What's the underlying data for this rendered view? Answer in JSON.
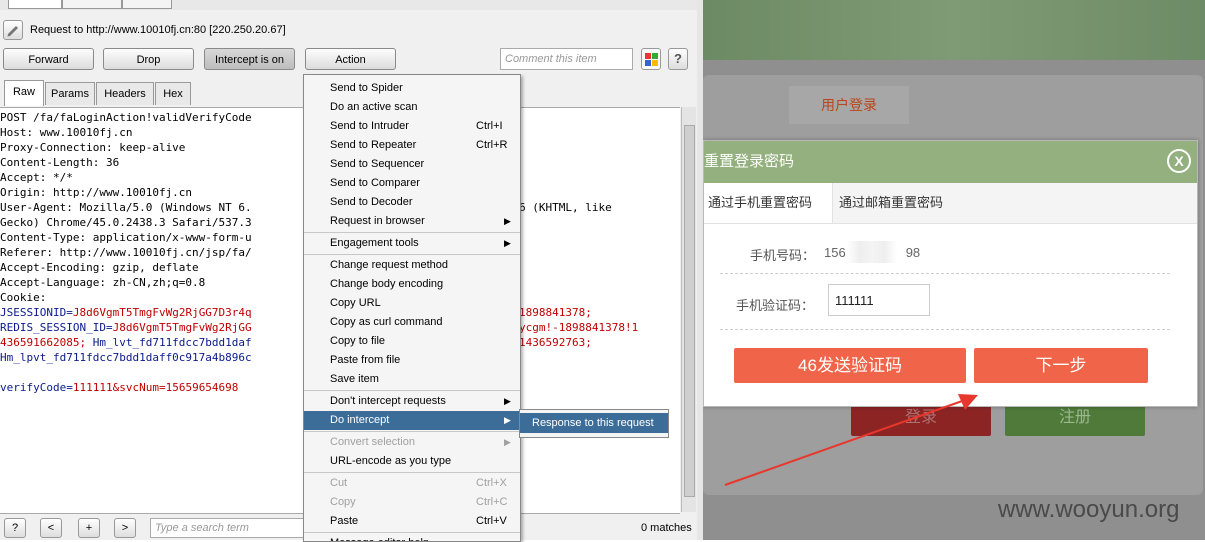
{
  "request_line": "Request to http://www.10010fj.cn:80  [220.250.20.67]",
  "toolbar": {
    "forward": "Forward",
    "drop": "Drop",
    "intercept": "Intercept is on",
    "action": "Action",
    "comment_placeholder": "Comment this item",
    "help": "?"
  },
  "tabs": [
    "Raw",
    "Params",
    "Headers",
    "Hex"
  ],
  "request_lines": [
    {
      "t": "POST /fa/faLoginAction!validVerifyCode",
      "c": ""
    },
    {
      "t": "Host: www.10010fj.cn",
      "c": ""
    },
    {
      "t": "Proxy-Connection: keep-alive",
      "c": ""
    },
    {
      "t": "Content-Length: 36",
      "c": ""
    },
    {
      "t": "Accept: */*",
      "c": ""
    },
    {
      "t": "Origin: http://www.10010fj.cn",
      "c": ""
    },
    {
      "t": "User-Agent: Mozilla/5.0 (Windows NT 6.",
      "c": ""
    },
    {
      "t": "Gecko) Chrome/45.0.2438.3 Safari/537.3",
      "c": ""
    },
    {
      "t": "Content-Type: application/x-www-form-u",
      "c": ""
    },
    {
      "t": "Referer: http://www.10010fj.cn/jsp/fa/",
      "c": ""
    },
    {
      "t": "Accept-Encoding: gzip, deflate",
      "c": ""
    },
    {
      "t": "Accept-Language: zh-CN,zh;q=0.8",
      "c": ""
    },
    {
      "t": "Cookie:",
      "c": ""
    },
    {
      "t": "JSESSIONID=J8d6VgmT5TmgFvWg2RjGG7D3r4q",
      "c": "mix1"
    },
    {
      "t": "REDIS_SESSION_ID=J8d6VgmT5TmgFvWg2RjGG",
      "c": "mix1"
    },
    {
      "t": "436591662085; Hm_lvt_fd711fdcc7bdd1daf",
      "c": "mix2"
    },
    {
      "t": "Hm_lpvt_fd711fdcc7bdd1daff0c917a4b896c",
      "c": "blue"
    },
    {
      "t": "",
      "c": ""
    },
    {
      "t": "verifyCode=111111&svcNum=15659654698",
      "c": "mix3"
    }
  ],
  "request_right": [
    {
      "line": 6,
      "t": "6 (KHTML, like"
    },
    {
      "line": 13,
      "t": "1898841378;",
      "c": "red"
    },
    {
      "line": 14,
      "t": "ycgm!-1898841378!1",
      "c": "red"
    },
    {
      "line": 15,
      "t": "1436592763;",
      "c": "red"
    }
  ],
  "context_menu": [
    {
      "label": "Send to Spider",
      "shortcut": ""
    },
    {
      "label": "Do an active scan",
      "shortcut": ""
    },
    {
      "label": "Send to Intruder",
      "shortcut": "Ctrl+I"
    },
    {
      "label": "Send to Repeater",
      "shortcut": "Ctrl+R"
    },
    {
      "label": "Send to Sequencer",
      "shortcut": ""
    },
    {
      "label": "Send to Comparer",
      "shortcut": ""
    },
    {
      "label": "Send to Decoder",
      "shortcut": ""
    },
    {
      "label": "Request in browser",
      "shortcut": "",
      "submenu": true
    },
    {
      "sep": true
    },
    {
      "label": "Engagement tools",
      "shortcut": "",
      "submenu": true
    },
    {
      "sep": true
    },
    {
      "label": "Change request method",
      "shortcut": ""
    },
    {
      "label": "Change body encoding",
      "shortcut": ""
    },
    {
      "label": "Copy URL",
      "shortcut": ""
    },
    {
      "label": "Copy as curl command",
      "shortcut": ""
    },
    {
      "label": "Copy to file",
      "shortcut": ""
    },
    {
      "label": "Paste from file",
      "shortcut": ""
    },
    {
      "label": "Save item",
      "shortcut": ""
    },
    {
      "sep": true
    },
    {
      "label": "Don't intercept requests",
      "shortcut": "",
      "submenu": true
    },
    {
      "label": "Do intercept",
      "shortcut": "",
      "submenu": true,
      "highlight": true
    },
    {
      "sep": true
    },
    {
      "label": "Convert selection",
      "shortcut": "",
      "submenu": true,
      "disabled": true
    },
    {
      "label": "URL-encode as you type",
      "shortcut": ""
    },
    {
      "sep": true
    },
    {
      "label": "Cut",
      "shortcut": "Ctrl+X",
      "disabled": true
    },
    {
      "label": "Copy",
      "shortcut": "Ctrl+C",
      "disabled": true
    },
    {
      "label": "Paste",
      "shortcut": "Ctrl+V"
    },
    {
      "sep": true
    },
    {
      "label": "Message editor help",
      "shortcut": ""
    }
  ],
  "submenu_item": "Response to this request",
  "search": {
    "help": "?",
    "prev": "<",
    "add": "+",
    "next": ">",
    "placeholder": "Type a search term",
    "matches": "0 matches"
  },
  "web": {
    "login_tab": "用户登录",
    "modal_title": "重置登录密码",
    "close": "X",
    "tab_phone": "通过手机重置密码",
    "tab_email": "通过邮箱重置密码",
    "phone_label": "手机号码：",
    "phone_prefix": "156",
    "phone_suffix": "98",
    "code_label": "手机验证码：",
    "code_value": "111111",
    "send_button": "46发送验证码",
    "next_button": "下一步",
    "login_button": "登录",
    "register_button": "注册",
    "watermark": "www.wooyun.org"
  },
  "colors": {
    "menu_highlight": "#3c6c98",
    "modal_header": "#94b07e",
    "orange_button": "#f0644a",
    "arrow": "#e8372c"
  }
}
